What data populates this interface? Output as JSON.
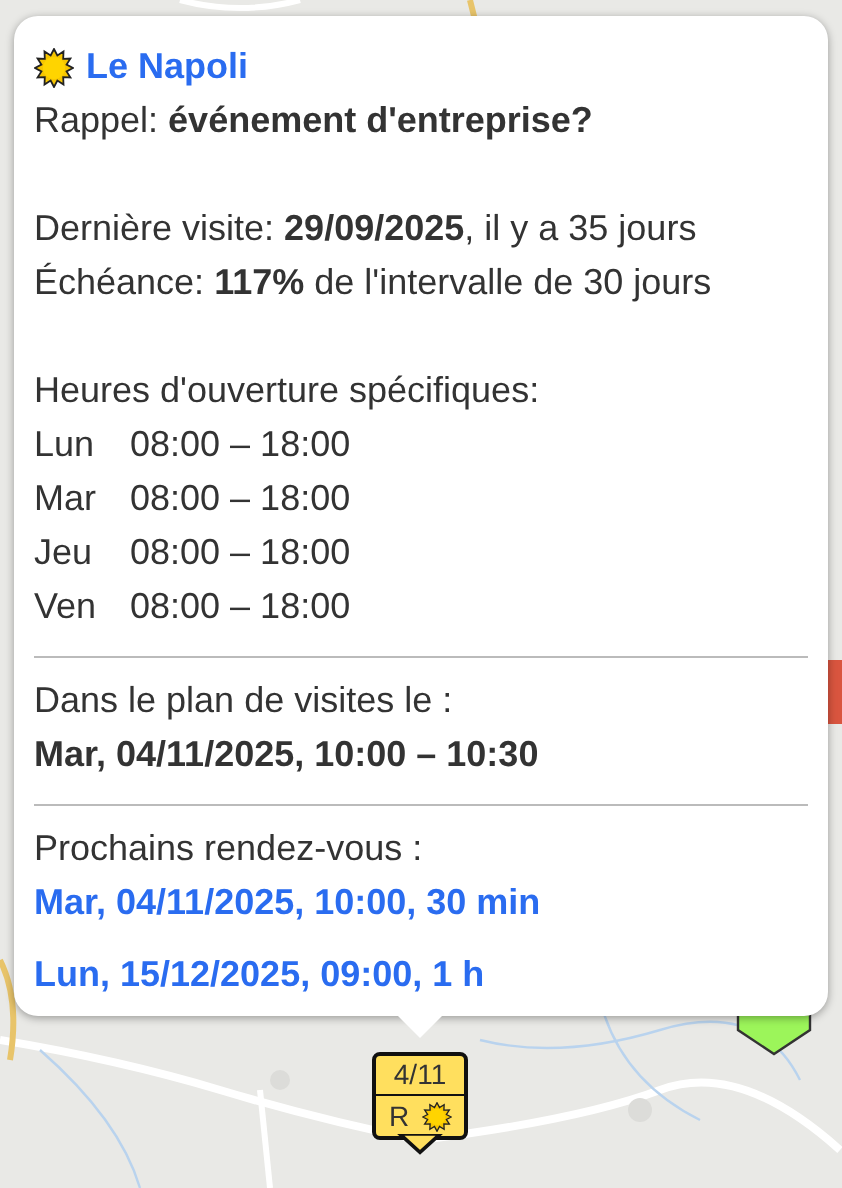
{
  "popup": {
    "title": "Le Napoli",
    "reminder": "Rappel: **événement d'entreprise?**",
    "last_visit": "Dernière visite: **29/09/2025**, il y a 35 jours",
    "due": "Échéance: **117%** de l'intervalle de 30 jours",
    "hours_title": "Heures d'ouverture spécifiques:",
    "hours": [
      {
        "day": "Lun",
        "time": "08:00 – 18:00"
      },
      {
        "day": "Mar",
        "time": "08:00 – 18:00"
      },
      {
        "day": "Jeu",
        "time": "08:00 – 18:00"
      },
      {
        "day": "Ven",
        "time": "08:00 – 18:00"
      }
    ],
    "plan": {
      "label": "Dans le plan de visites le :",
      "value": "Mar, 04/11/2025, 10:00 – 10:30"
    },
    "appointments": {
      "label": "Prochains rendez-vous :",
      "items": [
        "Mar, 04/11/2025, 10:00, 30 min",
        "Lun, 15/12/2025, 09:00, 1 h"
      ]
    }
  },
  "marker": {
    "date": "4/11",
    "letter": "R"
  }
}
